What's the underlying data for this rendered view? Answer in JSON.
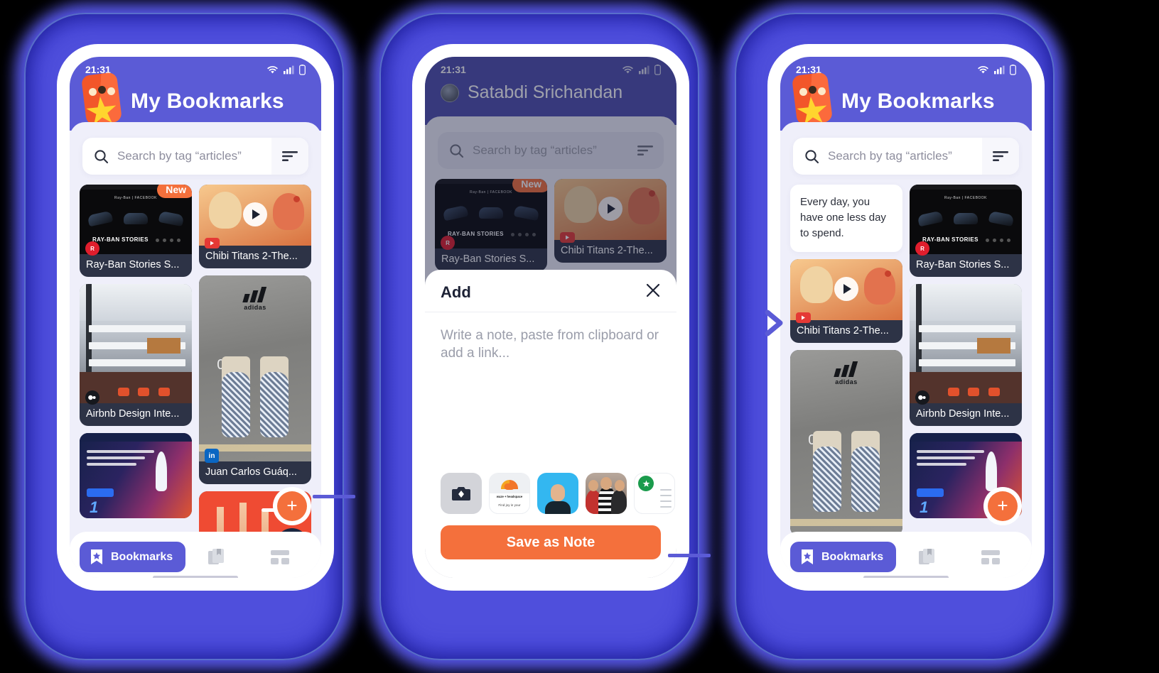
{
  "meta": {
    "accent_purple": "#5B5BD6",
    "accent_orange": "#F4703C",
    "card_dark": "#2D3346",
    "page_background": "#000000",
    "glow_color": "#5555E8"
  },
  "status_bar": {
    "time": "21:31",
    "icons": [
      "wifi-icon",
      "cellular-signal-icon",
      "battery-icon"
    ]
  },
  "header": {
    "title": "My Bookmarks",
    "logo_name": "bookmark-star-logo"
  },
  "search": {
    "placeholder": "Search by tag “articles”",
    "search_icon": "search-icon",
    "filter_icon": "sort-filter-icon"
  },
  "bottom_nav": {
    "items": [
      {
        "label": "Bookmarks",
        "icon": "bookmark-star-icon",
        "active": true
      },
      {
        "label": "",
        "icon": "collections-icon",
        "active": false
      },
      {
        "label": "",
        "icon": "grid-layout-icon",
        "active": false
      }
    ]
  },
  "fab": {
    "label": "+",
    "icon": "plus-icon"
  },
  "cards": {
    "new_badge": "New",
    "rayban": {
      "caption": "Ray-Ban Stories S...",
      "thumb_brand": "Ray-Ban | FACEBOOK",
      "thumb_word": "RAY-BAN STORIES",
      "source_icon": "rayban-icon"
    },
    "chibi": {
      "caption": "Chibi Titans 2-The...",
      "source_icon": "youtube-icon",
      "overlay_icon": "play-icon"
    },
    "airbnb": {
      "caption": "Airbnb Design Inte...",
      "source_icon": "video-icon"
    },
    "juan": {
      "caption": "Juan Carlos Guáq...",
      "source_icon": "linkedin-icon",
      "thumb_brand": "adidas"
    },
    "startup": {
      "caption": "",
      "number": "1"
    },
    "red": {
      "caption": ""
    },
    "note": {
      "text": "Every day, you have one less day to spend."
    }
  },
  "phone2": {
    "user_name": "Satabdi Srichandan",
    "avatar_name": "user-avatar",
    "sheet": {
      "title": "Add",
      "close_icon": "close-icon",
      "placeholder": "Write a note, paste from clipboard or add a link...",
      "save_label": "Save as Note",
      "app_shortcuts": [
        {
          "name": "camera-shortcut",
          "label": ""
        },
        {
          "name": "waze-headspace-shortcut",
          "label_top": "waze +  headspace",
          "label_bottom": "Find joy in your"
        },
        {
          "name": "portrait-photo-shortcut",
          "label": ""
        },
        {
          "name": "group-selfie-shortcut",
          "label": ""
        },
        {
          "name": "certificate-shortcut",
          "label": ""
        }
      ]
    }
  },
  "flow": {
    "arrow_icon": "chevron-right-arrow",
    "connector_color": "#5B5BD6"
  }
}
